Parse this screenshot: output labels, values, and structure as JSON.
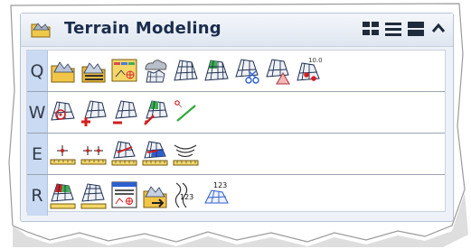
{
  "panel": {
    "title": "Terrain Modeling",
    "title_icon": "terrain-folder-icon",
    "view_buttons": [
      {
        "name": "grid-view-button",
        "icon": "grid-icon"
      },
      {
        "name": "list-view-button",
        "icon": "list-icon"
      },
      {
        "name": "large-list-view-button",
        "icon": "large-list-icon"
      },
      {
        "name": "collapse-button",
        "icon": "chevron-up-icon"
      }
    ]
  },
  "rows": [
    {
      "key": "Q",
      "tools": [
        "terrain-folder-icon",
        "terrain-folder-open-icon",
        "element-selection-icon",
        "terrain-from-cloud-icon",
        "terrain-mesh-icon",
        "terrain-green-mesh-icon",
        "terrain-clip-icon",
        "terrain-shape-icon",
        "terrain-spot-elevation-icon"
      ],
      "spot_label": "10.0"
    },
    {
      "key": "W",
      "tools": [
        "terrain-point-target-icon",
        "add-terrain-feature-icon",
        "remove-terrain-feature-icon",
        "edit-feature-icon",
        "slope-line-icon"
      ]
    },
    {
      "key": "E",
      "tools": [
        "profile-point-icon",
        "profile-points-icon",
        "profile-mesh-icon",
        "profile-blue-mesh-icon",
        "contour-profile-icon"
      ]
    },
    {
      "key": "R",
      "tools": [
        "terrain-analysis-icon",
        "terrain-compare-icon",
        "terrain-report-icon",
        "terrain-export-icon",
        "contour-labels-icon",
        "triangle-labels-icon"
      ],
      "contour_label": "123",
      "triangle_label": "123"
    }
  ],
  "colors": {
    "panel_bg": "#eef2f8",
    "row_key_bg": "#c9daf2",
    "title_text": "#1b2d4d"
  }
}
